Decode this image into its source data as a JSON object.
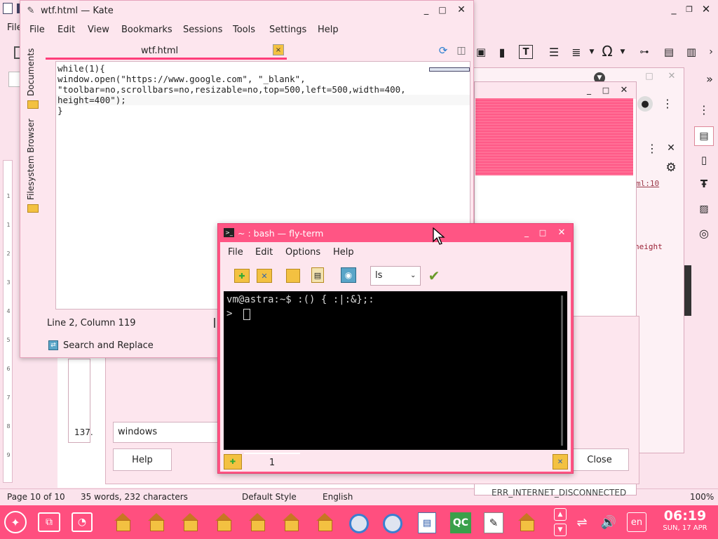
{
  "background_app": {
    "menu_file": "File",
    "page_status": "Page 10 of 10",
    "words_status": "35 words, 232 characters",
    "style_status": "Default Style",
    "lang_status": "English",
    "zoom_status": "100%",
    "ruler_marks": [
      "1",
      "1",
      "2",
      "3",
      "4",
      "5",
      "6",
      "7",
      "8",
      "9",
      "10"
    ]
  },
  "chrome_dialog": {
    "code_ref": "ml:10",
    "code_word": "height",
    "error": "ERR_INTERNET_DISCONNECTED"
  },
  "find_dialog": {
    "input_value": "windows",
    "help_label": "Help",
    "close_label": "Close",
    "side_number": "137."
  },
  "kate": {
    "title": "wtf.html — Kate",
    "menu": [
      "File",
      "Edit",
      "View",
      "Bookmarks",
      "Sessions",
      "Tools",
      "Settings",
      "Help"
    ],
    "tab_label": "wtf.html",
    "side_documents": "Documents",
    "side_filesystem": "Filesystem Browser",
    "code_lines": [
      "while(1){",
      "window.open(\"https://www.google.com\", \"_blank\",",
      "\"toolbar=no,scrollbars=no,resizable=no,top=500,left=500,width=400,",
      "height=400\");",
      "}"
    ],
    "cursor_status": "Line 2, Column 119",
    "search_replace": "Search and Replace"
  },
  "terminal": {
    "title": "~ : bash — fly-term",
    "menu": [
      "File",
      "Edit",
      "Options",
      "Help"
    ],
    "command_select": "ls",
    "line1": "vm@astra:~$ :() { :|:&};:",
    "line2": ">",
    "tab_number": "1"
  },
  "taskbar": {
    "keyboard_lang": "en",
    "time": "06:19",
    "date": "SUN, 17 APR",
    "qc_label": "QC"
  },
  "colors": {
    "accent": "#ff4f7f",
    "window_bg": "#fde6ee",
    "terminal_bg": "#000000"
  }
}
